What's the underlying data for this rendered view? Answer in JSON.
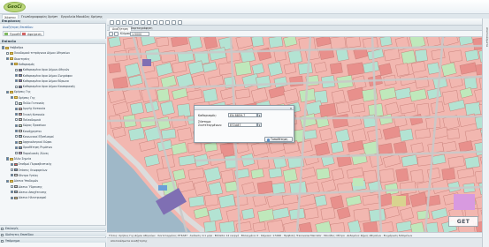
{
  "app": {
    "logo_text": "GeoCi"
  },
  "menu": {
    "items": [
      "Χάρτης",
      "Γεωπληροφορίες",
      "Χρήστ",
      "Εργαλεία",
      "Μονάδες Χρήσης"
    ]
  },
  "left_panel": {
    "header": "Επιφάνειες",
    "search_label": "Αναζήτηση Επιπέδου",
    "buttons": {
      "add": "Προσθήκη",
      "remove": "Αφαίρεση"
    },
    "layers_header": "Επίπεδα",
    "tree": [
      {
        "label": "Υπόβαθρα",
        "level": 0,
        "type": "folder"
      },
      {
        "label": "Οικοδομικά τετράγωνα Δήμου Αθηναίων",
        "level": 1,
        "type": "folder"
      },
      {
        "label": "Ιδιοκτησίες",
        "level": 1,
        "type": "folder"
      },
      {
        "label": "Καθορισμός",
        "level": 2,
        "type": "folder"
      },
      {
        "label": "Καθορισμένα όρια Δήμων Αθηνών",
        "level": 3,
        "type": "layer",
        "color": "#7f6fb3"
      },
      {
        "label": "Καθορισμένα όρια Δήμου Ζωγράφου",
        "level": 3,
        "type": "layer",
        "color": "#6f82c9"
      },
      {
        "label": "Καθορισμένα όρια Δήμου Βύρωνα",
        "level": 3,
        "type": "layer",
        "color": "#8c6fc0"
      },
      {
        "label": "Καθορισμένα όρια Δήμου Καισαριανής",
        "level": 3,
        "type": "layer",
        "color": "#5d6db8"
      },
      {
        "label": "Χρήσεις Γης",
        "level": 1,
        "type": "folder"
      },
      {
        "label": "Χρήσεις Γης",
        "level": 2,
        "type": "folder"
      },
      {
        "label": "Πεδίο Γειτονιάς",
        "level": 3,
        "type": "layer",
        "color": "#b3e3d3"
      },
      {
        "label": "Αμιγής Κατοικία",
        "level": 3,
        "type": "layer",
        "color": "#f2b7b0"
      },
      {
        "label": "Γενική Κατοικία",
        "level": 3,
        "type": "layer",
        "color": "#e8908c"
      },
      {
        "label": "Πολεοδομικά",
        "level": 3,
        "type": "layer",
        "color": "#c9c9c9"
      },
      {
        "label": "Χώρος Πρασίνου",
        "level": 3,
        "type": "layer",
        "color": "#bfe8bb"
      },
      {
        "label": "Κοινόχρηστοι",
        "level": 3,
        "type": "layer",
        "color": "#ffffff"
      },
      {
        "label": "Κοινωνικοί Εξοπλισμοί",
        "level": 3,
        "type": "layer",
        "color": "#9fd1e8"
      },
      {
        "label": "Αρχαιολογικοί Χώροι",
        "level": 3,
        "type": "layer",
        "color": "#d8d38f"
      },
      {
        "label": "Οριοθέτηση Ρεμάτων",
        "level": 3,
        "type": "layer",
        "color": "#6ca1d8"
      },
      {
        "label": "Παραλιακές Ζώνες",
        "level": 3,
        "type": "layer",
        "color": "#d9a3e3"
      },
      {
        "label": "Άλλα Σημεία",
        "level": 1,
        "type": "folder"
      },
      {
        "label": "Σταθμοί Πυροσβεστικής",
        "level": 2,
        "type": "layer",
        "color": "#e55c5c"
      },
      {
        "label": "Στάσεις Λεωφορείων",
        "level": 2,
        "type": "layer",
        "color": "#6c9fd8"
      },
      {
        "label": "Κέντρα Υγείας",
        "level": 2,
        "type": "layer",
        "color": "#e5e5e5"
      },
      {
        "label": "Δίκτυα Υποδομών",
        "level": 1,
        "type": "folder"
      },
      {
        "label": "Δίκτυο Ύδρευσης",
        "level": 2,
        "type": "layer",
        "color": "#c0c0c0"
      },
      {
        "label": "Δίκτυο Αποχέτευσης",
        "level": 2,
        "type": "layer",
        "color": "#8fb6d8"
      },
      {
        "label": "Δίκτυο Ηλεκτρισμού",
        "level": 2,
        "type": "layer",
        "color": "#e8c46a"
      },
      {
        "label": "Κοινόχρηστοι Χώροι",
        "level": 1,
        "type": "folder"
      },
      {
        "label": "Χώροι Στάθμευσης",
        "level": 2,
        "type": "layer",
        "color": "#d4d4d4"
      },
      {
        "label": "Δημοτικά Κτίρια",
        "level": 2,
        "type": "layer",
        "color": "#b89ad6"
      },
      {
        "label": "Ζώνη Πρασίνου και Όγκοι της Παρέμβασης",
        "level": 2,
        "type": "layer",
        "color": "#9fd9b9"
      }
    ],
    "footer": [
      "Επιλογές",
      "Ιδιότητες Επιπέδου",
      "Υπόμνημα"
    ]
  },
  "toolbar": {
    "scale_label": "Κλίμακα",
    "scale_value": "1:5000"
  },
  "tabs": [
    {
      "label": "Αναζήτηση",
      "active": true
    },
    {
      "label": "Χαρτογράφηση",
      "active": false
    }
  ],
  "right_strip": {
    "label": "Αποτελέσματα"
  },
  "dialog": {
    "title": "",
    "fields": [
      {
        "label": "Καθαρισμός:",
        "value": "EN 8859-7"
      },
      {
        "label": "Σύστημα Συντεταγμένων:",
        "value": "ΕΓΣΑ87"
      }
    ],
    "button": "Τοποθέτηση"
  },
  "status_bar": {
    "text": "Τίτλος: Χρήσεις Γης Δήμου Αθηναίων · Συντεταγμένες: ΕΓΣΑ87 · Ανάλυση: 0.1 μ/px · Επίπεδα: 12 ενεργά · Επιλεγμένα: 0 · Κλίμακα: 1:5000 · Προβολή: Transverse Mercator · Μονάδες: Μέτρα · Δεδομένα: Δήμος Αθηναίων · Ενημέρωση δεδομένων"
  },
  "bottom_tab": {
    "label": "Αποτελέσματα Αναζήτησης"
  },
  "map": {
    "colors": {
      "residential": "#f2b7b0",
      "mixed": "#e8908c",
      "green": "#bfe8bb",
      "social": "#b3e3d3",
      "sea": "#9fb8c8",
      "road": "#c9c9c9",
      "purple": "#7f6fb3",
      "blue": "#6c9fd8",
      "yellow": "#d8d38f"
    },
    "watermark": "GET"
  }
}
